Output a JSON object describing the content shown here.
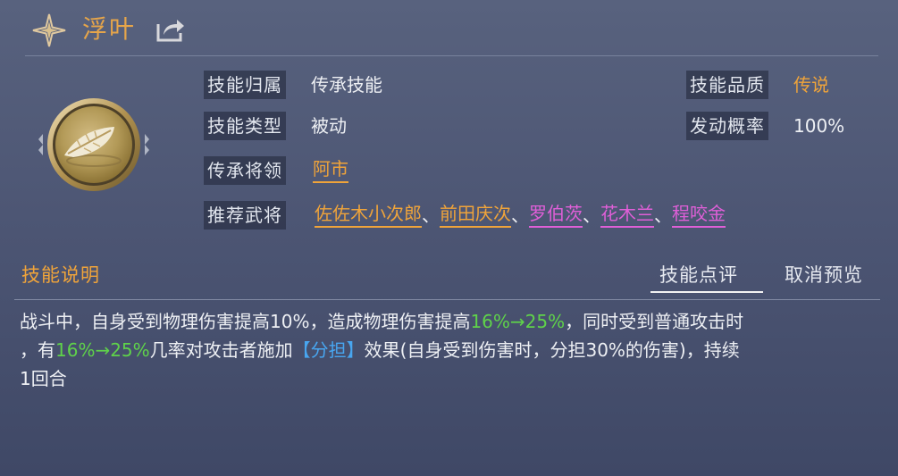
{
  "skill": {
    "name": "浮叶"
  },
  "info": {
    "belong_label": "技能归属",
    "belong_value": "传承技能",
    "quality_label": "技能品质",
    "quality_value": "传说",
    "type_label": "技能类型",
    "type_value": "被动",
    "chance_label": "发动概率",
    "chance_value": "100%",
    "inherit_label": "传承将领",
    "inherit_value": "阿市",
    "recommend_label": "推荐武将",
    "recommend": [
      {
        "name": "佐佐木小次郎",
        "color": "#f0a43a"
      },
      {
        "name": "前田庆次",
        "color": "#f0a43a"
      },
      {
        "name": "罗伯茨",
        "color": "#e05fd8"
      },
      {
        "name": "花木兰",
        "color": "#e05fd8"
      },
      {
        "name": "程咬金",
        "color": "#e05fd8"
      }
    ],
    "separator": "、"
  },
  "section": {
    "title": "技能说明",
    "tab_review": "技能点评",
    "tab_cancel": "取消预览"
  },
  "description": {
    "p1": "战斗中，自身受到物理伤害提高10%，造成物理伤害提高",
    "g1": "16%→25%",
    "p2": "，同时受到普通攻击时",
    "p3": "，有",
    "g2": "16%→25%",
    "p4": "几率对攻击者施加",
    "b1": "【分担】",
    "p5": "效果(自身受到伤害时，分担30%的伤害)，持续",
    "p6": "1回合"
  },
  "colors": {
    "accent_orange": "#f0a43a",
    "pink": "#e05fd8",
    "green": "#5fd24a",
    "blue": "#48a6f0"
  }
}
